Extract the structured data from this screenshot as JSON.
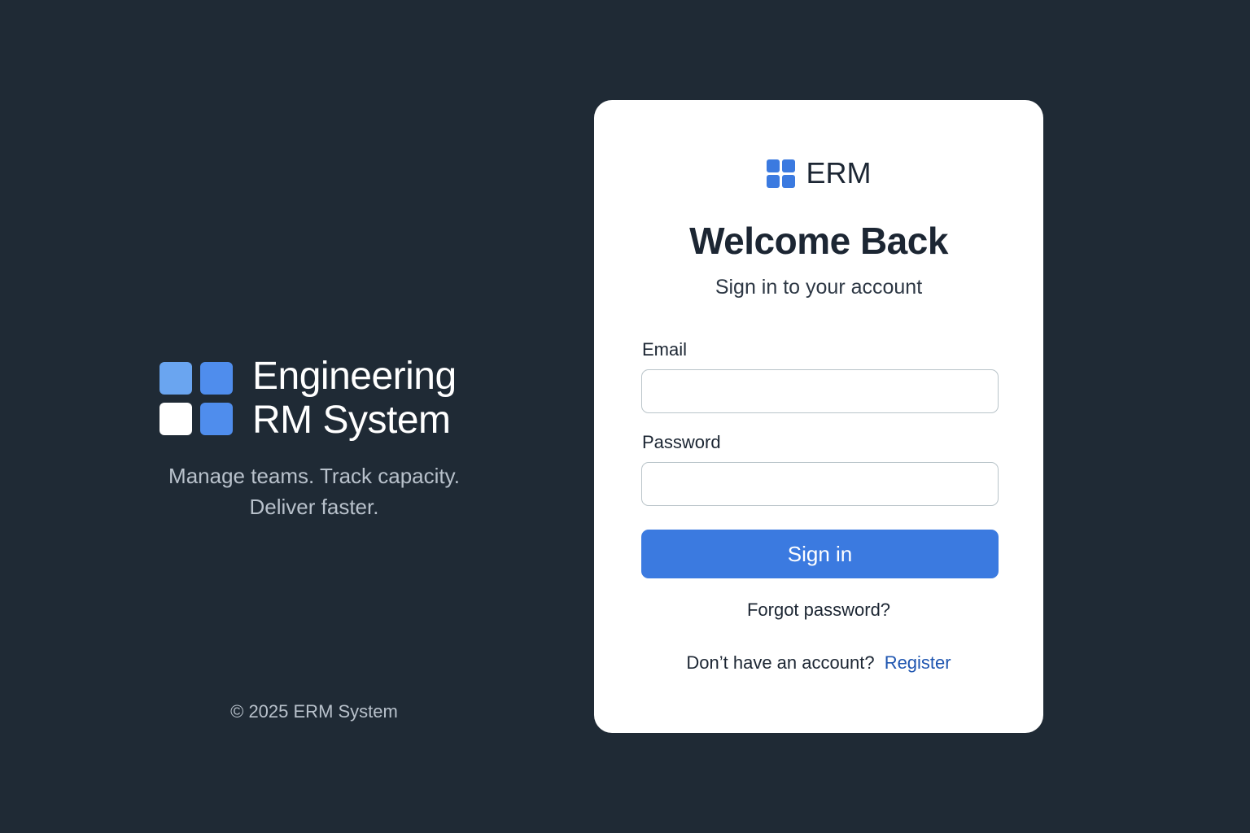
{
  "brand": {
    "title_line1": "Engineering",
    "title_line2": "RM System",
    "logo_icon": "four-squares-logo-icon",
    "logo_colors": [
      "#6aa5f0",
      "#4f8ded",
      "#ffffff",
      "#4f8ded"
    ],
    "tagline_line1": "Manage teams. Track capacity.",
    "tagline_line2": "Deliver faster.",
    "copyright": "© 2025 ERM System"
  },
  "login": {
    "logo_icon": "four-squares-logo-icon",
    "logo_text": "ERM",
    "heading": "Welcome Back",
    "subheading": "Sign in to your account",
    "email_label": "Email",
    "email_value": "",
    "password_label": "Password",
    "password_value": "",
    "submit_label": "Sign in",
    "forgot_label": "Forgot password?",
    "register_prompt": "Don’t have an account?",
    "register_link": "Register"
  },
  "colors": {
    "background": "#1f2a35",
    "accent": "#3b7ae0",
    "link": "#1e55b0",
    "card": "#ffffff"
  }
}
